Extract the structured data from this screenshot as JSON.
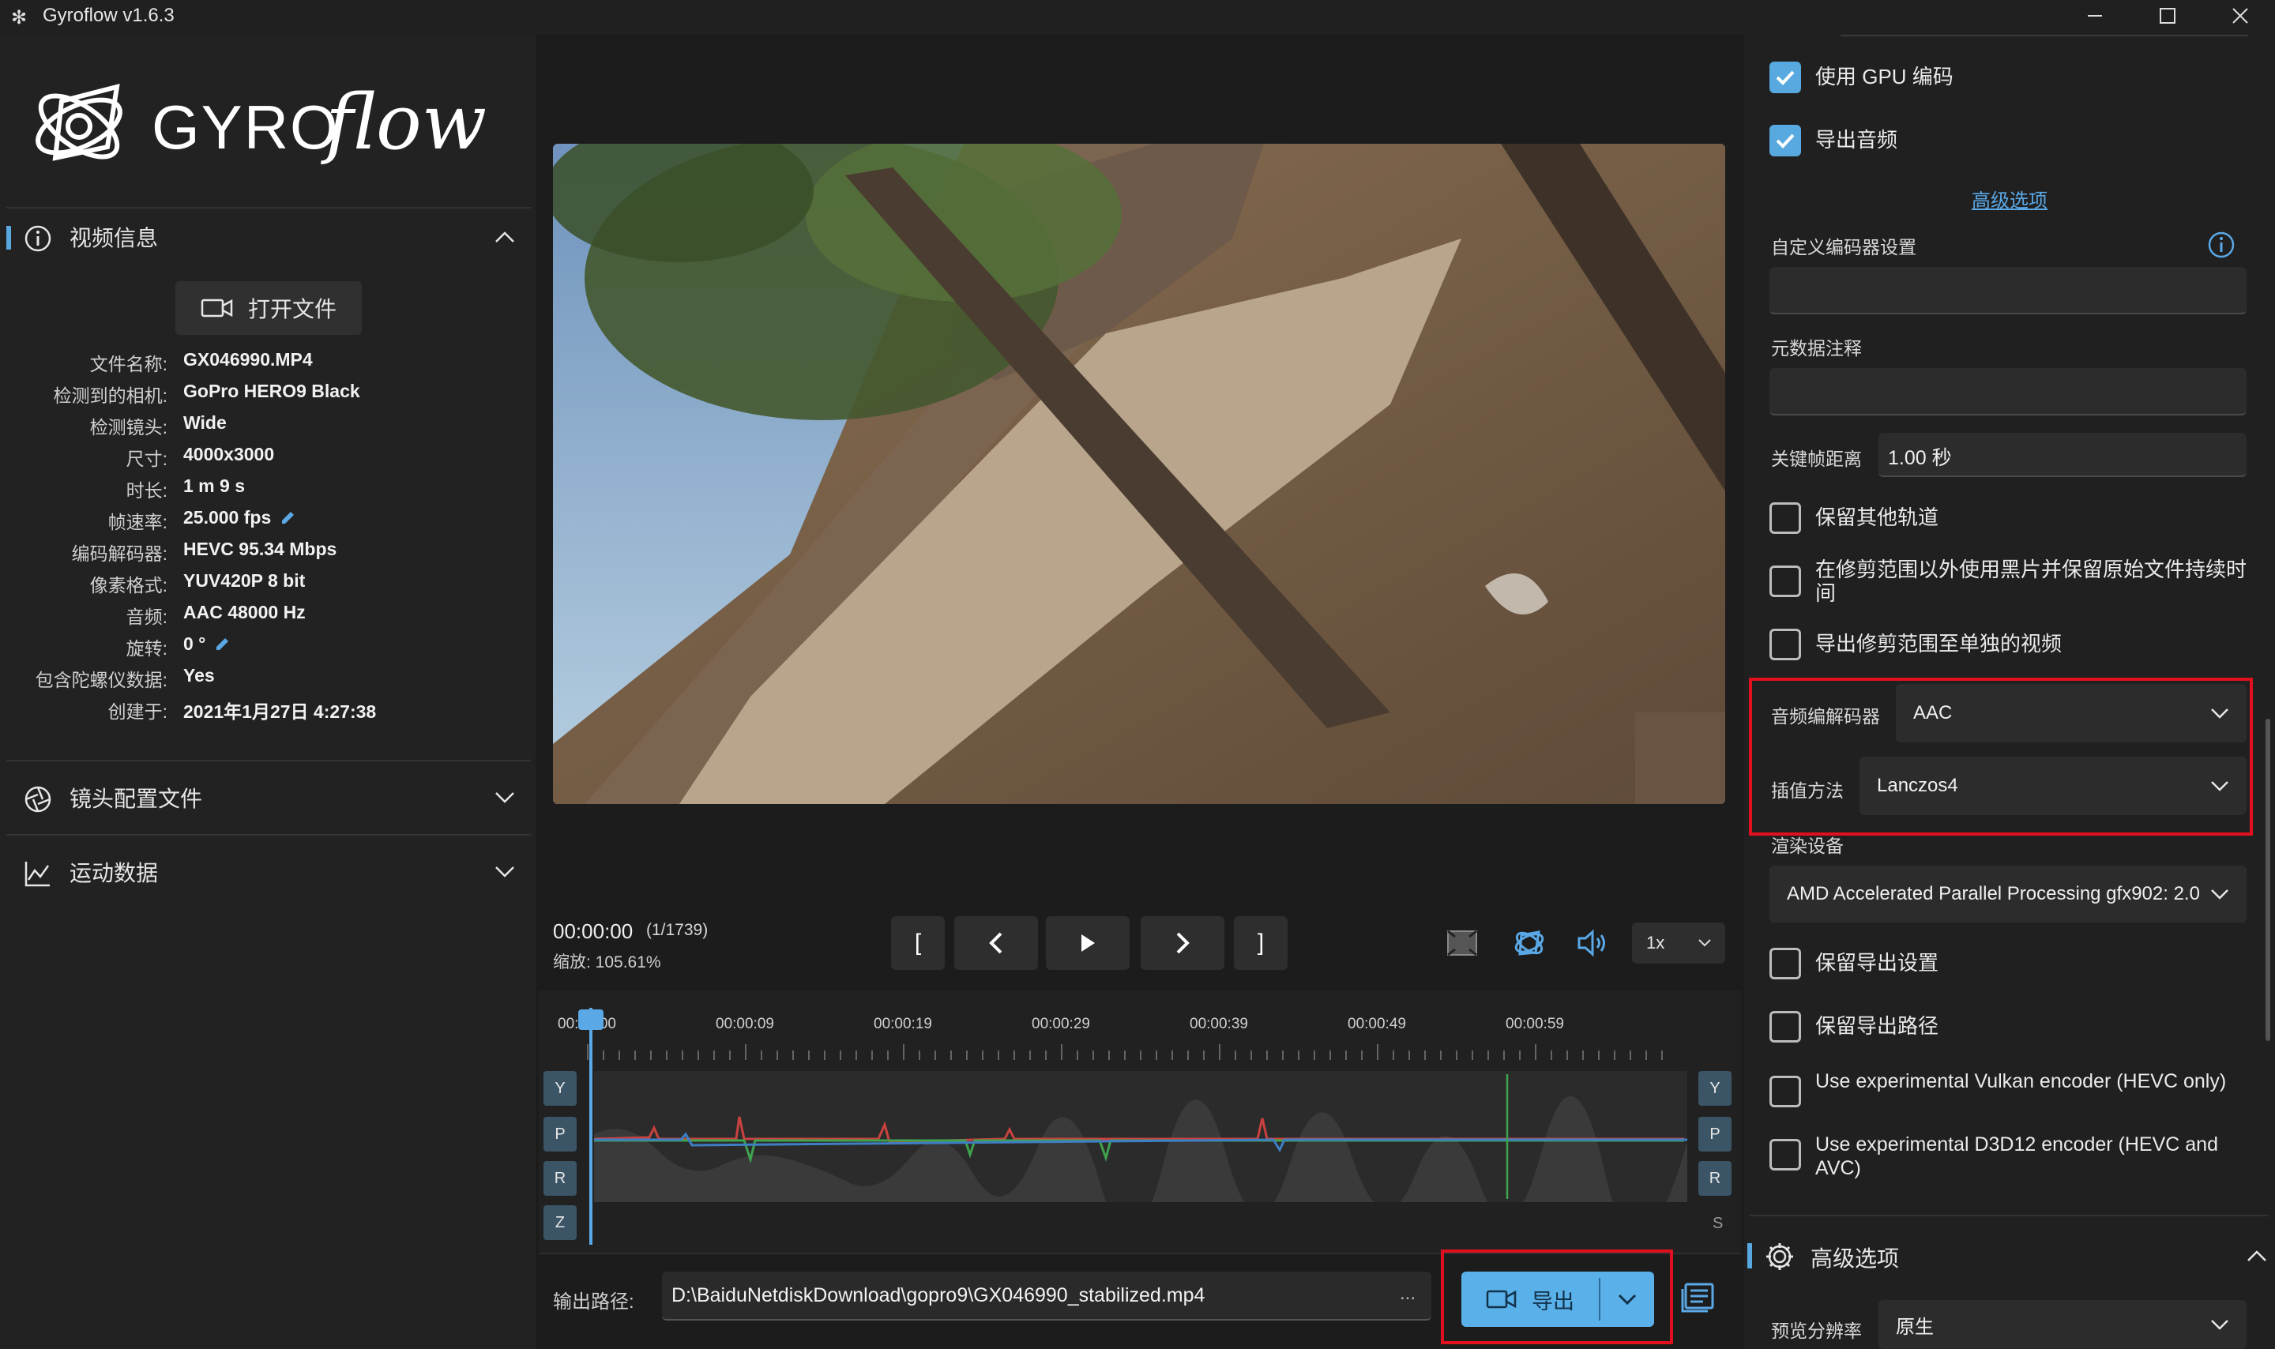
{
  "window": {
    "title": "Gyroflow v1.6.3"
  },
  "logo": {
    "text": "GYRO",
    "script": "flow"
  },
  "left": {
    "video_info": {
      "header": "视频信息",
      "open_file": "打开文件",
      "rows": [
        {
          "key": "文件名称:",
          "value": "GX046990.MP4"
        },
        {
          "key": "检测到的相机:",
          "value": "GoPro HERO9 Black"
        },
        {
          "key": "检测镜头:",
          "value": "Wide"
        },
        {
          "key": "尺寸:",
          "value": "4000x3000"
        },
        {
          "key": "时长:",
          "value": "1 m 9 s"
        },
        {
          "key": "帧速率:",
          "value": "25.000 fps"
        },
        {
          "key": "编码解码器:",
          "value": "HEVC 95.34 Mbps"
        },
        {
          "key": "像素格式:",
          "value": "YUV420P 8 bit"
        },
        {
          "key": "音频:",
          "value": "AAC 48000 Hz"
        },
        {
          "key": "旋转:",
          "value": "0 °"
        },
        {
          "key": "包含陀螺仪数据:",
          "value": "Yes"
        },
        {
          "key": "创建于:",
          "value": "2021年1月27日 4:27:38"
        }
      ]
    },
    "lens_profile": {
      "header": "镜头配置文件"
    },
    "motion_data": {
      "header": "运动数据"
    }
  },
  "player": {
    "timecode": "00:00:00",
    "frames": "(1/1739)",
    "zoom": "缩放: 105.61%",
    "speed": "1x",
    "bracket_in": "[",
    "bracket_out": "]"
  },
  "timeline": {
    "ticks": [
      "00:00:00",
      "00:00:09",
      "00:00:19",
      "00:00:29",
      "00:00:39",
      "00:00:49",
      "00:00:59"
    ],
    "axes_left": [
      "Y",
      "P",
      "R",
      "Z"
    ],
    "axes_right": [
      "Y",
      "P",
      "R"
    ],
    "s_label": "S"
  },
  "output": {
    "label": "输出路径:",
    "path": "D:\\BaiduNetdiskDownload\\gopro9\\GX046990_stabilized.mp4",
    "dots": "...",
    "export": "导出"
  },
  "right": {
    "use_gpu": "使用 GPU 编码",
    "export_audio": "导出音频",
    "advanced_link": "高级选项",
    "custom_encoder": "自定义编码器设置",
    "metadata_comment": "元数据注释",
    "keyframe_label": "关键帧距离",
    "keyframe_value": "1.00 秒",
    "keep_tracks": "保留其他轨道",
    "black_outside": "在修剪范围以外使用黑片并保留原始文件持续时间",
    "export_trim": "导出修剪范围至单独的视频",
    "audio_codec_label": "音频编解码器",
    "audio_codec_value": "AAC",
    "interp_label": "插值方法",
    "interp_value": "Lanczos4",
    "render_device_label": "渲染设备",
    "render_device_value": "AMD Accelerated Parallel Processing gfx902: 2.0",
    "keep_export_settings": "保留导出设置",
    "keep_export_path": "保留导出路径",
    "vulkan": "Use experimental Vulkan encoder (HEVC only)",
    "d3d12": "Use experimental D3D12 encoder (HEVC and AVC)",
    "advanced_header": "高级选项",
    "preview_res_label": "预览分辨率",
    "preview_res_value": "原生"
  },
  "colors": {
    "accent": "#58a9e0",
    "highlight": "#e0101e",
    "export_button": "#5ab0e8"
  }
}
